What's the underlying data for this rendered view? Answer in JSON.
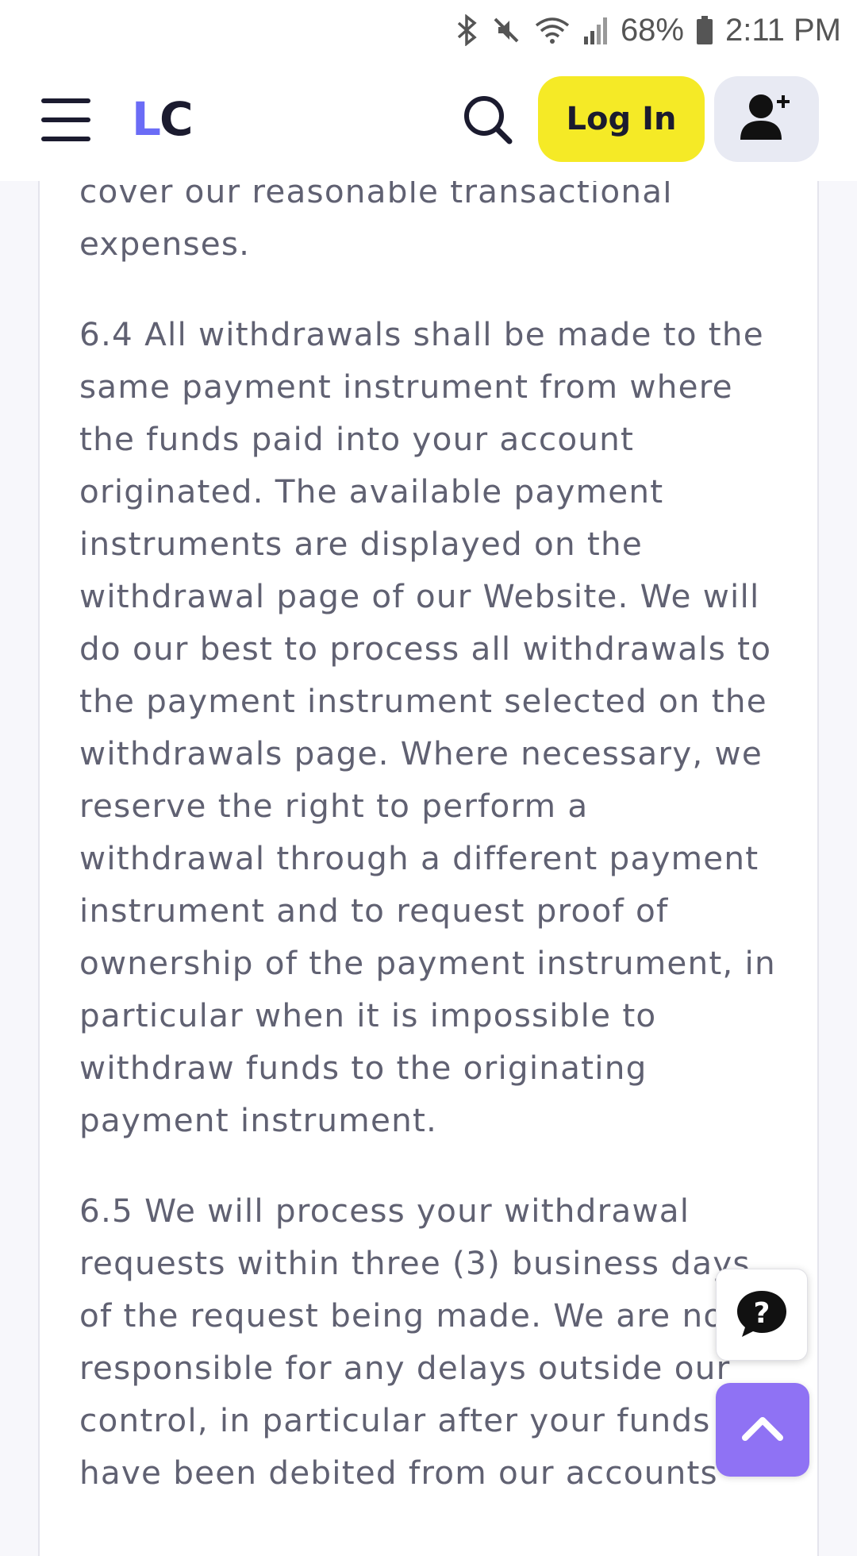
{
  "status_bar": {
    "battery": "68%",
    "time": "2:11 PM",
    "icons": [
      "bluetooth-icon",
      "mute-icon",
      "wifi-icon",
      "signal-icon",
      "battery-icon"
    ]
  },
  "header": {
    "logo_first": "L",
    "logo_second": "C",
    "login_label": "Log In",
    "icons": [
      "menu-icon",
      "search-icon",
      "add-user-icon"
    ]
  },
  "content": {
    "fragment": "cover our reasonable transactional expenses.",
    "para_6_4": "6.4 All withdrawals shall be made to the same payment instrument from where the funds paid into your account originated. The available payment instruments are displayed on the withdrawal page of our Website. We will do our best to process all withdrawals to the payment instrument selected on the withdrawals page. Where necessary, we reserve the right to perform a withdrawal through a different payment instrument and to request proof of ownership of the payment instrument, in particular when it is impossible to withdraw funds to the originating payment instrument.",
    "para_6_5": "6.5 We will process your withdrawal requests within three (3) business days of the request being made. We are not responsible for any delays outside our control, in particular after your funds have been debited from our accounts"
  },
  "floating": {
    "help_icon": "question-chat-icon",
    "top_icon": "chevron-up-icon"
  },
  "colors": {
    "logo_accent": "#6b6cf6",
    "login_bg": "#f5ea26",
    "top_button_bg": "#8f72f4",
    "text": "#606172"
  }
}
